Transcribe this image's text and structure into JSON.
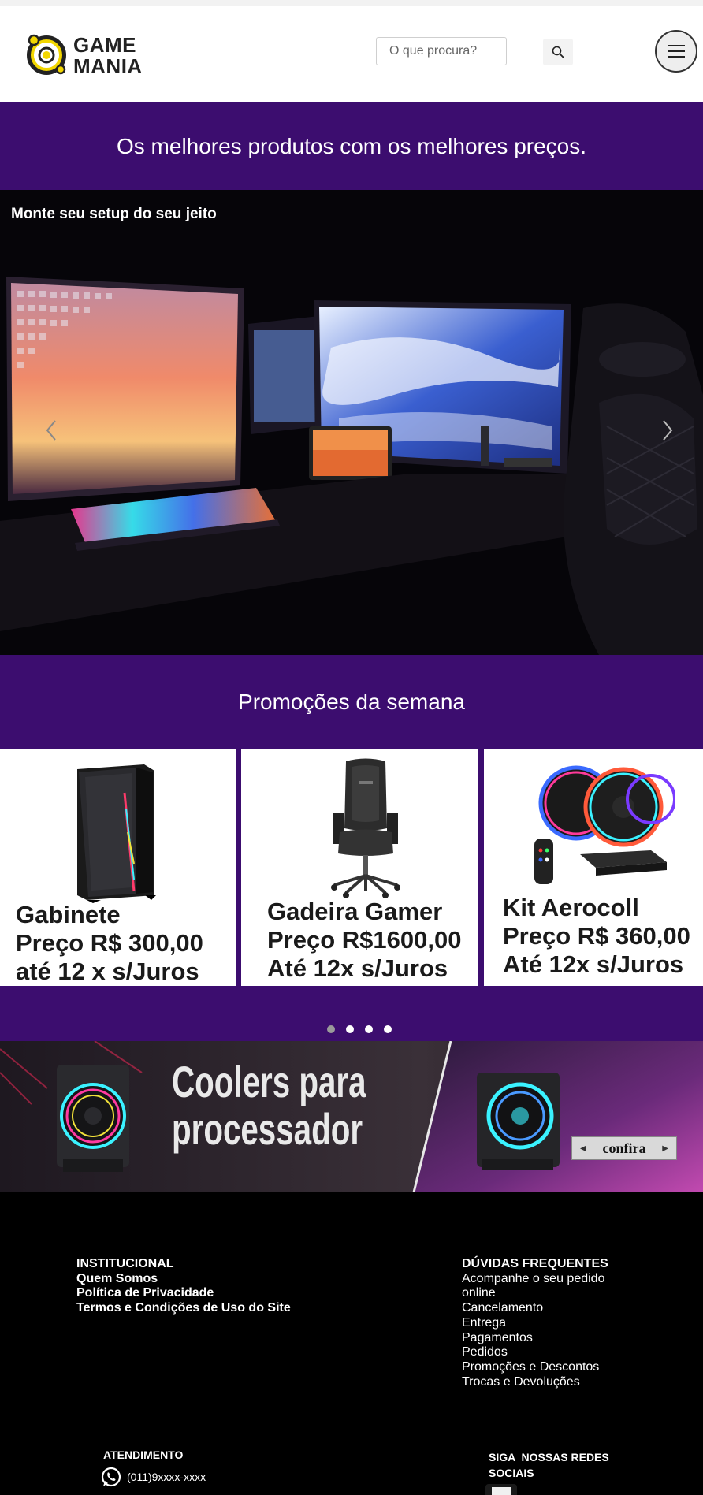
{
  "header": {
    "logo_text_1": "GAME",
    "logo_text_2": "MANIA",
    "search_placeholder": "O que procura?"
  },
  "banner": {
    "tagline": "Os melhores produtos com os melhores preços."
  },
  "hero": {
    "caption": "Monte seu setup do seu jeito"
  },
  "promos": {
    "title": "Promoções da semana",
    "cards": [
      {
        "line1": "Gabinete",
        "line2": "Preço R$ 300,00",
        "line3": "até 12 x s/Juros"
      },
      {
        "line1": "Gadeira Gamer",
        "line2": "Preço R$1600,00",
        "line3": "Até 12x s/Juros"
      },
      {
        "line1": "Kit Aerocoll",
        "line2": "Preço R$ 360,00",
        "line3": "Até 12x s/Juros"
      }
    ],
    "active_slide": 1,
    "slide_count": 4
  },
  "coolers_banner": {
    "line1": "Coolers para",
    "line2": "processador",
    "button": "confira"
  },
  "footer": {
    "institucional": {
      "title": "INSTITUCIONAL",
      "links": [
        "Quem Somos",
        "Política de Privacidade",
        "Termos e Condições de Uso do Site"
      ]
    },
    "duvidas": {
      "title": "DÚVIDAS FREQUENTES",
      "links": [
        "Acompanhe o seu pedido",
        "online",
        "Cancelamento",
        "Entrega",
        "Pagamentos",
        "Pedidos",
        "Promoções e Descontos",
        "Trocas e Devoluções"
      ]
    },
    "atendimento": {
      "title": "ATENDIMENTO",
      "phone": "(011)9xxxx-xxxx"
    },
    "social": {
      "title_1": "SIGA  NOSSAS REDES",
      "title_2": "SOCIAIS"
    }
  },
  "colors": {
    "brand_purple": "#3c0d6f",
    "logo_yellow": "#f2d600",
    "footer_bg": "#000000"
  }
}
